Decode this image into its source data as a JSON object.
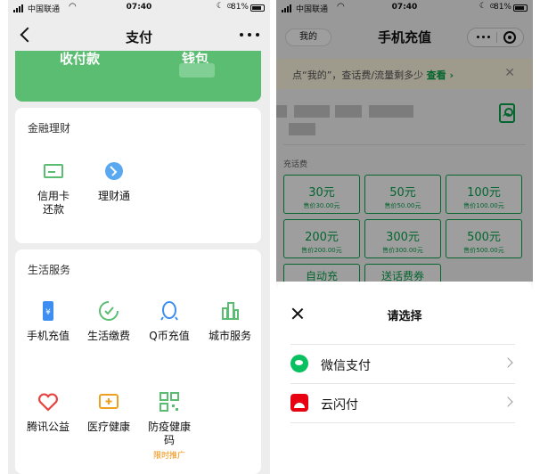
{
  "left": {
    "status": {
      "carrier": "中国联通",
      "time": "07:40",
      "battery": "81%"
    },
    "nav": {
      "title": "支付"
    },
    "card": {
      "receive_pay": "收付款",
      "wallet": "钱包"
    },
    "finance": {
      "title": "金融理财",
      "items": [
        {
          "label": "信用卡\n还款",
          "icon": "credit-card-icon"
        },
        {
          "label": "理财通",
          "icon": "wealth-icon"
        }
      ]
    },
    "life": {
      "title": "生活服务",
      "items": [
        {
          "label": "手机充值",
          "icon": "phone-icon"
        },
        {
          "label": "生活缴费",
          "icon": "utility-icon"
        },
        {
          "label": "Q币充值",
          "icon": "qq-icon"
        },
        {
          "label": "城市服务",
          "icon": "city-icon"
        },
        {
          "label": "腾讯公益",
          "icon": "charity-icon"
        },
        {
          "label": "医疗健康",
          "icon": "medical-icon"
        },
        {
          "label": "防疫健康\n码",
          "icon": "qr-health-icon",
          "tag": "限时推广"
        }
      ]
    }
  },
  "right": {
    "status": {
      "carrier": "中国联通",
      "time": "07:40",
      "battery": "81%"
    },
    "nav": {
      "title": "手机充值",
      "my_label": "我的"
    },
    "notice": {
      "text": "点“我的”，查话费/流量剩多少 ",
      "link": "查看"
    },
    "fee_label": "充话费",
    "amounts": [
      {
        "amount": "30元",
        "price": "售价30.00元"
      },
      {
        "amount": "50元",
        "price": "售价50.00元"
      },
      {
        "amount": "100元",
        "price": "售价100.00元"
      },
      {
        "amount": "200元",
        "price": "售价200.00元"
      },
      {
        "amount": "300元",
        "price": "售价300.00元"
      },
      {
        "amount": "500元",
        "price": "售价500.00元"
      }
    ],
    "extras": [
      "自动充",
      "送话费券"
    ],
    "sheet": {
      "title": "请选择",
      "options": [
        {
          "label": "微信支付",
          "icon": "wechat-pay-icon"
        },
        {
          "label": "云闪付",
          "icon": "unionpay-icon"
        }
      ]
    }
  },
  "colors": {
    "green": "#07a34b",
    "card_green": "#5bbd72",
    "wechat": "#07c160",
    "unionpay": "#e60012"
  }
}
